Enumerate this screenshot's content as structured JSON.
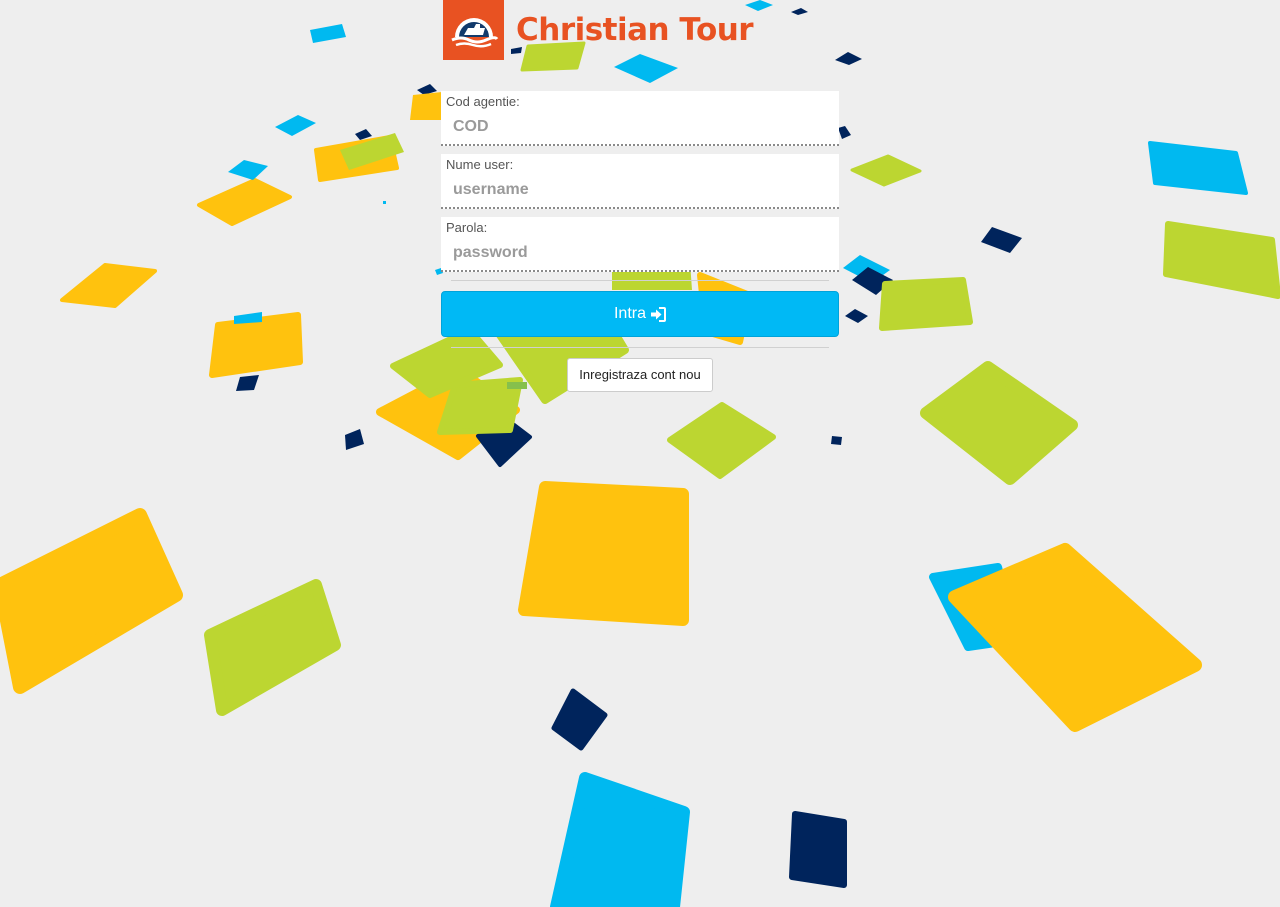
{
  "brand": {
    "name": "Christian Tour",
    "logo_icon": "ship-wave-logo-icon",
    "color": "#e85222"
  },
  "form": {
    "agency_code": {
      "label": "Cod agentie:",
      "placeholder": "COD",
      "value": ""
    },
    "username": {
      "label": "Nume user:",
      "placeholder": "username",
      "value": ""
    },
    "password": {
      "label": "Parola:",
      "placeholder": "password",
      "value": ""
    },
    "login_button": {
      "label": "Intra",
      "icon": "sign-in-icon",
      "color": "#00b9f5"
    },
    "register_button": {
      "label": "Inregistraza cont nou"
    }
  },
  "background": {
    "description_colors": [
      "#ffc20e",
      "#bcd631",
      "#00b9f0",
      "#00245c"
    ]
  }
}
